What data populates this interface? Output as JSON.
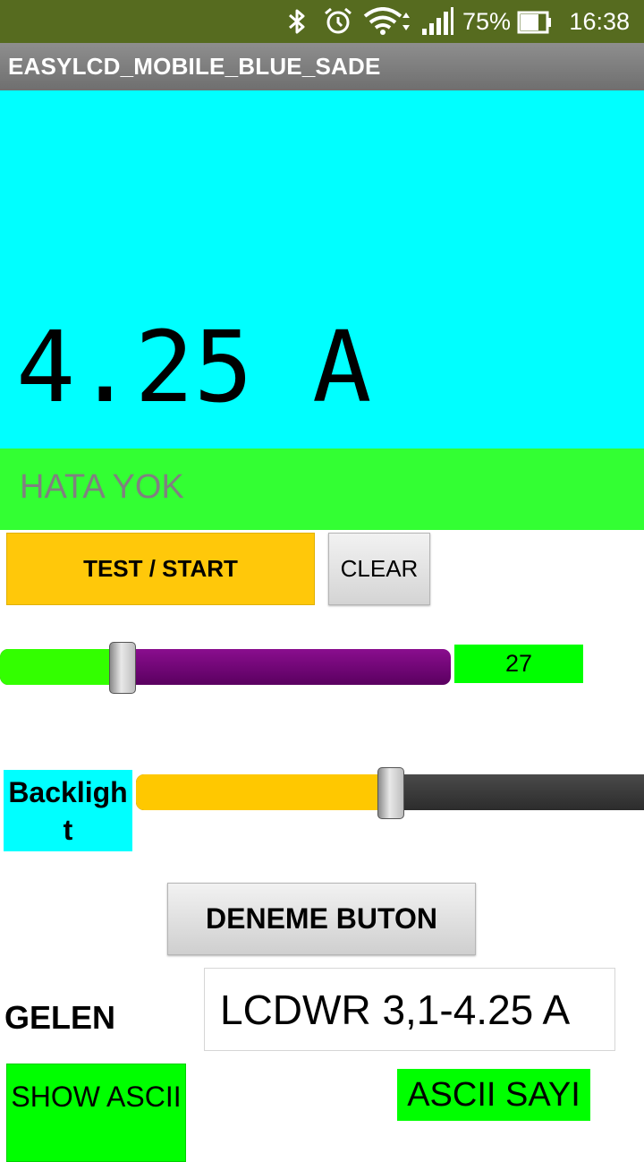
{
  "status_bar": {
    "battery_percent": "75%",
    "time": "16:38",
    "icons": [
      "bluetooth-icon",
      "alarm-icon",
      "wifi-icon",
      "signal-icon",
      "battery-icon"
    ]
  },
  "app": {
    "title": "EASYLCD_MOBILE_BLUE_SADE"
  },
  "display": {
    "value": "4.25 A",
    "status": "HATA YOK"
  },
  "buttons": {
    "test_start": "TEST / START",
    "clear": "CLEAR",
    "deneme": "DENEME BUTON",
    "show_ascii": "SHOW ASCII"
  },
  "slider1": {
    "value_label": "27",
    "fraction": 0.27
  },
  "backlight": {
    "label": "Backlight",
    "fraction": 0.5
  },
  "received": {
    "label": "GELEN",
    "value": "LCDWR 3,1-4.25 A"
  },
  "ascii": {
    "label": "ASCII SAYI"
  },
  "colors": {
    "display_bg": "#00ffff",
    "status_bg": "#33ff33",
    "accent_yellow": "#ffc80a",
    "slider_purple": "#7a0a80",
    "green": "#00ff00"
  }
}
